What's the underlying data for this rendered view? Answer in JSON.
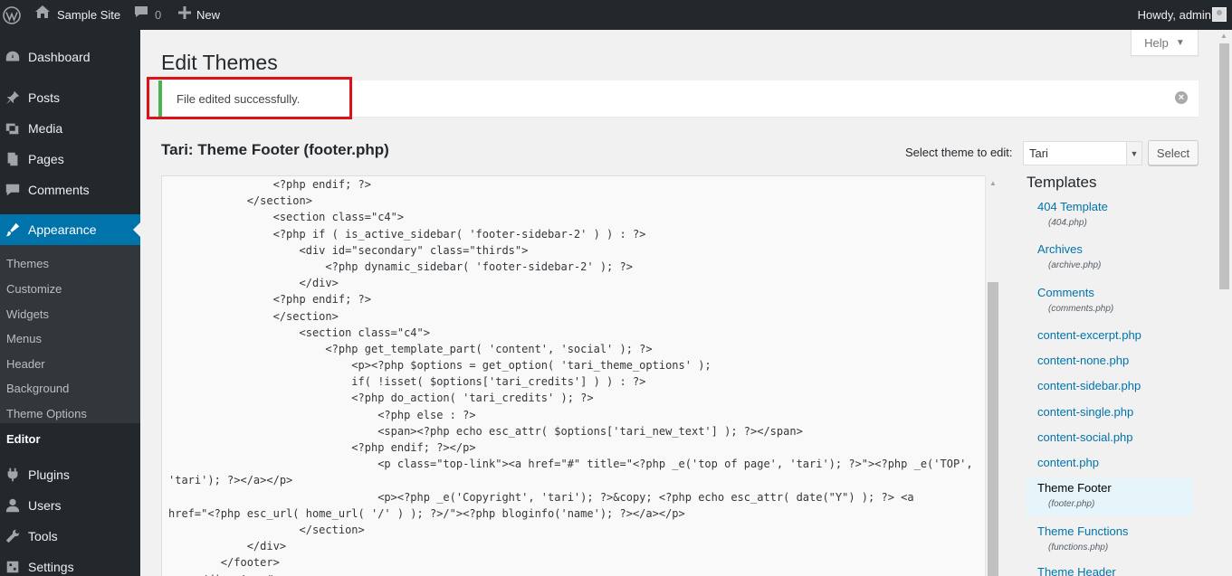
{
  "admin_bar": {
    "site_name": "Sample Site",
    "comments_count": "0",
    "new_label": "New",
    "howdy": "Howdy, admin"
  },
  "sidebar": {
    "items": [
      {
        "label": "Dashboard",
        "icon": "dashboard-icon"
      },
      {
        "label": "Posts",
        "icon": "pin-icon"
      },
      {
        "label": "Media",
        "icon": "media-icon"
      },
      {
        "label": "Pages",
        "icon": "pages-icon"
      },
      {
        "label": "Comments",
        "icon": "comment-icon"
      },
      {
        "label": "Appearance",
        "icon": "brush-icon"
      },
      {
        "label": "Plugins",
        "icon": "plugin-icon"
      },
      {
        "label": "Users",
        "icon": "users-icon"
      },
      {
        "label": "Tools",
        "icon": "tools-icon"
      },
      {
        "label": "Settings",
        "icon": "settings-icon"
      }
    ],
    "submenu": [
      "Themes",
      "Customize",
      "Widgets",
      "Menus",
      "Header",
      "Background",
      "Theme Options",
      "Editor"
    ]
  },
  "header": {
    "help_label": "Help",
    "page_title": "Edit Themes"
  },
  "notice": {
    "message": "File edited successfully."
  },
  "editor": {
    "file_title": "Tari: Theme Footer (footer.php)",
    "select_label": "Select theme to edit:",
    "selected_theme": "Tari",
    "select_button": "Select",
    "code_lines": [
      "                <?php endif; ?>",
      "            </section>",
      "                <section class=\"c4\">",
      "                <?php if ( is_active_sidebar( 'footer-sidebar-2' ) ) : ?>",
      "                    <div id=\"secondary\" class=\"thirds\">",
      "                        <?php dynamic_sidebar( 'footer-sidebar-2' ); ?>",
      "                    </div>",
      "                <?php endif; ?>",
      "                </section>",
      "                    <section class=\"c4\">",
      "                        <?php get_template_part( 'content', 'social' ); ?>",
      "                            <p><?php $options = get_option( 'tari_theme_options' );",
      "                            if( !isset( $options['tari_credits'] ) ) : ?>",
      "                            <?php do_action( 'tari_credits' ); ?>",
      "                                <?php else : ?>",
      "                                <span><?php echo esc_attr( $options['tari_new_text'] ); ?></span>",
      "                            <?php endif; ?></p>",
      "                                <p class=\"top-link\"><a href=\"#\" title=\"<?php _e('top of page', 'tari'); ?>\"><?php _e('TOP',",
      "'tari'); ?></a></p>",
      "                                <p><?php _e('Copyright', 'tari'); ?>&copy; <?php echo esc_attr( date(\"Y\") ); ?> <a",
      "href=\"<?php esc_url( home_url( '/' ) ); ?>/\"><?php bloginfo('name'); ?></a></p>",
      "                    </section>",
      "            </div>",
      "        </footer>",
      "    </div><!-- #page -->"
    ]
  },
  "templates": {
    "title": "Templates",
    "items": [
      {
        "name": "404 Template",
        "file": "(404.php)"
      },
      {
        "name": "Archives",
        "file": "(archive.php)"
      },
      {
        "name": "Comments",
        "file": "(comments.php)"
      },
      {
        "name": "content-excerpt.php",
        "file": ""
      },
      {
        "name": "content-none.php",
        "file": ""
      },
      {
        "name": "content-sidebar.php",
        "file": ""
      },
      {
        "name": "content-single.php",
        "file": ""
      },
      {
        "name": "content-social.php",
        "file": ""
      },
      {
        "name": "content.php",
        "file": ""
      },
      {
        "name": "Theme Footer",
        "file": "(footer.php)"
      },
      {
        "name": "Theme Functions",
        "file": "(functions.php)"
      },
      {
        "name": "Theme Header",
        "file": ""
      }
    ]
  },
  "colors": {
    "admin_dark": "#23282d",
    "accent_blue": "#0073aa",
    "success_green": "#46b450",
    "highlight_red": "#e0101a"
  }
}
